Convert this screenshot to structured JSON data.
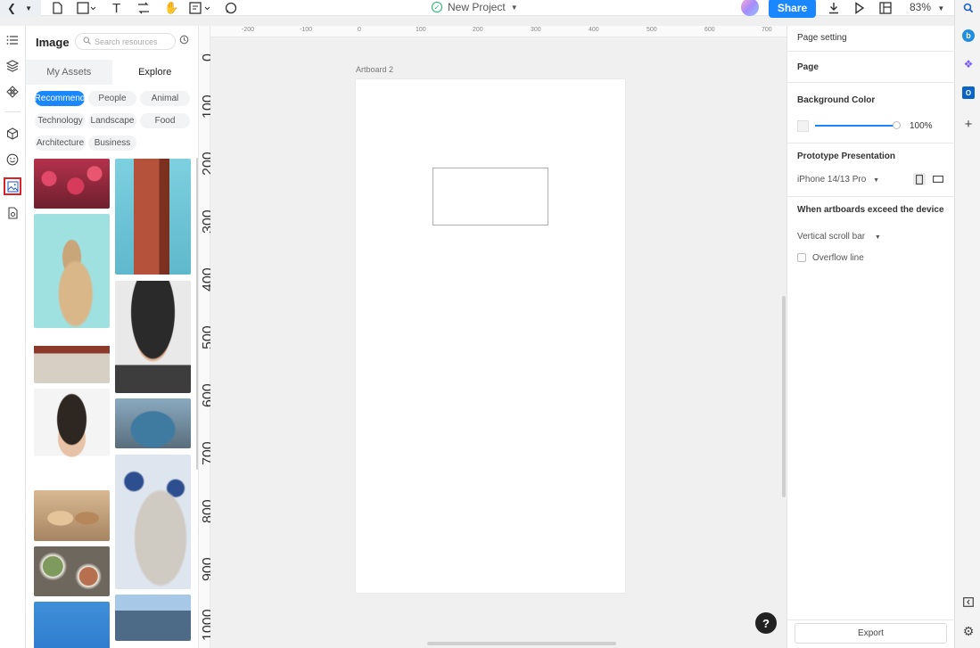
{
  "toolbar": {
    "project_title": "New Project",
    "share_label": "Share",
    "zoom": "83%",
    "icons": [
      "back-icon",
      "menu-caret-icon",
      "page-icon",
      "rectangle-icon",
      "text-icon",
      "connector-icon",
      "hand-icon",
      "note-icon",
      "comment-icon"
    ]
  },
  "rail": {
    "icons": [
      "outline-icon",
      "layers-icon",
      "components-icon",
      "cube-icon",
      "emoji-icon",
      "image-icon",
      "file-image-icon"
    ],
    "active": "image-icon"
  },
  "panel": {
    "title": "Image",
    "search_placeholder": "Search resources",
    "tabs": [
      "My Assets",
      "Explore"
    ],
    "active_tab": "Explore",
    "chips": [
      "Recommend",
      "People",
      "Animal",
      "Technology",
      "Landscape",
      "Food",
      "Architecture",
      "Business"
    ],
    "active_chip": "Recommend"
  },
  "rulers": {
    "horizontal": [
      "-200",
      "-100",
      "0",
      "100",
      "200",
      "300",
      "400",
      "500",
      "600",
      "700"
    ],
    "vertical": [
      "0",
      "100",
      "200",
      "300",
      "400",
      "500",
      "600",
      "700",
      "800",
      "900",
      "1000"
    ]
  },
  "canvas": {
    "artboard_label": "Artboard 2",
    "help_label": "?"
  },
  "props": {
    "page_setting": "Page setting",
    "page": "Page",
    "background_color": "Background Color",
    "opacity": "100%",
    "prototype_presentation": "Prototype Presentation",
    "device": "iPhone 14/13 Pro",
    "exceed_title": "When artboards exceed the device",
    "scroll_mode": "Vertical scroll bar",
    "overflow_line": "Overflow line",
    "export_label": "Export"
  },
  "colors": {
    "accent": "#1a87ff",
    "active_outline": "#d8232a",
    "success": "#26b26b"
  }
}
